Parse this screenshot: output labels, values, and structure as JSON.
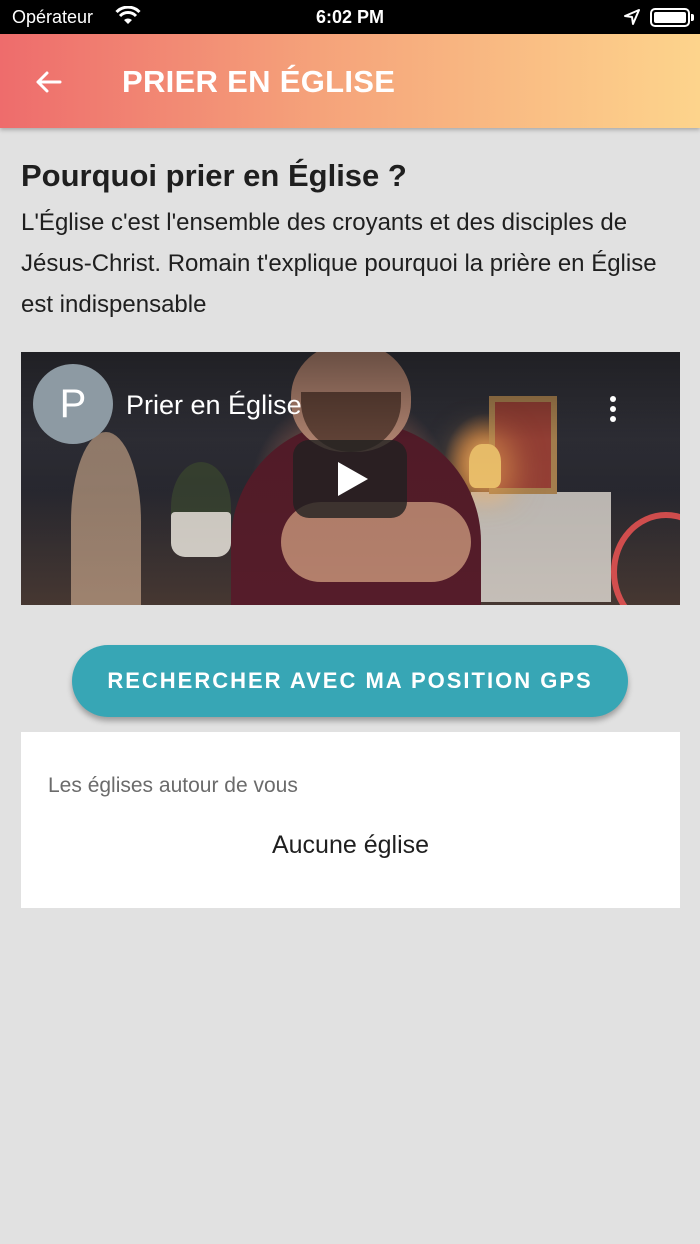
{
  "status_bar": {
    "carrier": "Opérateur",
    "time": "6:02 PM"
  },
  "app_bar": {
    "title": "PRIER EN ÉGLISE",
    "back_icon": "arrow-left-icon",
    "background_gradient": [
      "#ee6c6c",
      "#f5a27a",
      "#fdd48c"
    ]
  },
  "intro": {
    "heading": "Pourquoi prier en Église ?",
    "description": "L'Église c'est l'ensemble des croyants et des disciples de Jésus-Christ. Romain t'explique pourquoi la prière en Église est indispensable"
  },
  "video": {
    "channel_initial": "P",
    "title": "Prier en Église",
    "play_icon": "play-icon",
    "menu_icon": "more-vertical-icon"
  },
  "gps_button": {
    "label": "RECHERCHER AVEC MA POSITION GPS",
    "color": "#37a6b5"
  },
  "churches_card": {
    "caption": "Les églises autour de vous",
    "empty_text": "Aucune église"
  }
}
